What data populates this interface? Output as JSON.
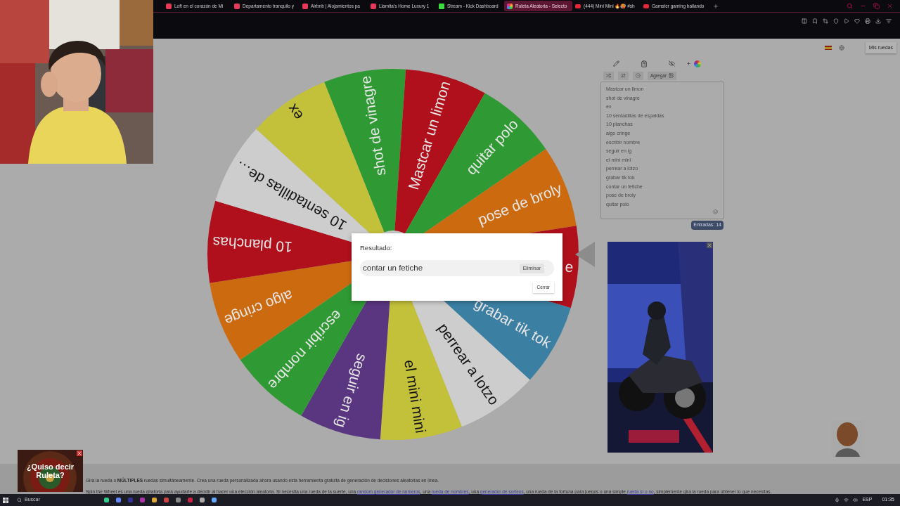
{
  "browser": {
    "tabs": [
      {
        "kind": "airbnb",
        "title": "Loft en el corazón de Mi",
        "selected": false
      },
      {
        "kind": "airbnb",
        "title": "Departamento tranquilo y",
        "selected": false
      },
      {
        "kind": "airbnb",
        "title": "Airbnb | Alojamientos pa",
        "selected": false
      },
      {
        "kind": "airbnb",
        "title": "Llamita's Home Luxury 1",
        "selected": false
      },
      {
        "kind": "kick",
        "title": "Stream - Kick Dashboard",
        "selected": false
      },
      {
        "kind": "wheel",
        "title": "Ruleta Aleatoria - Selecto",
        "selected": true
      },
      {
        "kind": "youtube",
        "title": "(444) Mini Mini 🔥🥵 #sh",
        "selected": false
      },
      {
        "kind": "youtube",
        "title": "Gamster gaming bailando",
        "selected": false
      }
    ]
  },
  "page": {
    "my_wheels": "Mis ruedas",
    "wheel": {
      "segments": [
        {
          "label": "shot de vinagre",
          "color": "#2f9a34"
        },
        {
          "label": "Mastcar un limon",
          "color": "#b0101c"
        },
        {
          "label": "quitar polo",
          "color": "#2f9a34"
        },
        {
          "label": "pose de broly",
          "color": "#cc6a10"
        },
        {
          "label": "e",
          "color": "#b0101c"
        },
        {
          "label": "grabar tik tok",
          "color": "#3b7fa3"
        },
        {
          "label": "perrear a lotzo",
          "color": "#cdcdcd"
        },
        {
          "label": "el mini mini",
          "color": "#c3c03a"
        },
        {
          "label": "seguir en ig",
          "color": "#5a3680"
        },
        {
          "label": "escribir nombre",
          "color": "#2f9a34"
        },
        {
          "label": "algo cringe",
          "color": "#cc6a10"
        },
        {
          "label": "10 planchas",
          "color": "#b0101c"
        },
        {
          "label": "10 sentadillas de…",
          "color": "#cdcdcd"
        },
        {
          "label": "ex",
          "color": "#c3c03a"
        }
      ]
    },
    "editor": {
      "add_button": "Agregar",
      "entries": [
        "Mastcar un limon",
        "shot de vinagre",
        "ex",
        "10 sentadillas de espaldas",
        "10 planchas",
        "algo cringe",
        "escribir nombre",
        "seguir en ig",
        "el mini mini",
        "perrear a lotzo",
        "grabar tik tok",
        "contar un fetiche",
        "pose de broly",
        "quitar polo"
      ],
      "count": "Entradas: 14"
    },
    "dialog": {
      "label": "Resultado:",
      "result": "contar un fetiche",
      "remove_button": "Eliminar",
      "close_button": "Cerrar"
    },
    "suggestion": "¿Quiso decir Ruleta?",
    "description": {
      "line_1": "Gira la rueda o **MÚLTIPLES** ruedas simultáneamente. Crea una rueda personalizada ahora usando esta herramienta gratuita de generación de decisiones aleatorias en línea.",
      "line_2": [
        {
          "kind": "text",
          "text": "Spin the Wheel es una rueda giratoria para ayudarte a decidir al hacer una elección aleatoria. Si necesita una rueda de la suerte, una "
        },
        {
          "kind": "link",
          "text": "random generador de números"
        },
        {
          "kind": "text",
          "text": ", una "
        },
        {
          "kind": "link",
          "text": "rueda de nombres"
        },
        {
          "kind": "text",
          "text": ", una "
        },
        {
          "kind": "link",
          "text": "generador de sorteos"
        },
        {
          "kind": "text",
          "text": ", una rueda de la fortuna para juegos o una simple "
        },
        {
          "kind": "link",
          "text": "rueda sí o no"
        },
        {
          "kind": "text",
          "text": ", simplemente gira la rueda para obtener lo que necesitas."
        }
      ]
    }
  },
  "taskbar": {
    "search": "Buscar",
    "language": "ESP",
    "time": "01:35"
  }
}
